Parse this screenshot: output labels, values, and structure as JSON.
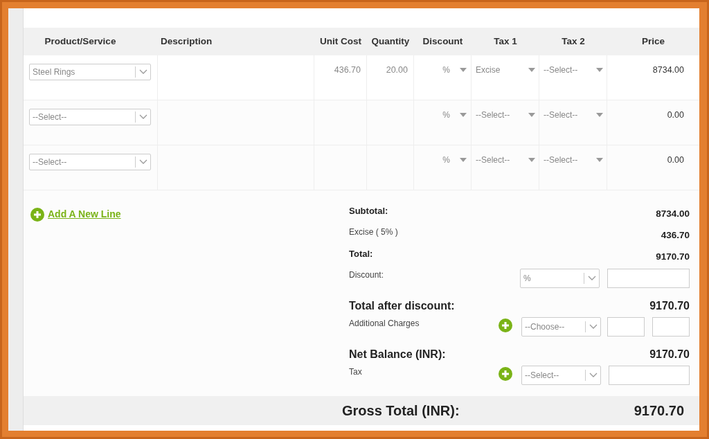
{
  "columns": [
    "Product/Service",
    "Description",
    "Unit Cost",
    "Quantity",
    "Discount",
    "Tax 1",
    "Tax 2",
    "Price"
  ],
  "rows": [
    {
      "product": "Steel Rings",
      "unit_cost": "436.70",
      "quantity": "20.00",
      "discount": "%",
      "tax_1": "Excise",
      "tax_2": "--Select--",
      "price": "8734.00"
    },
    {
      "product": "--Select--",
      "discount": "%",
      "tax_1": "--Select--",
      "tax_2": "--Select--",
      "price": "0.00"
    },
    {
      "product": "--Select--",
      "discount": "%",
      "tax_1": "--Select--",
      "tax_2": "--Select--",
      "price": "0.00"
    }
  ],
  "add_line": "Add A New Line",
  "summary": [
    {
      "kind": "bold",
      "label": "Subtotal:",
      "value": "8734.00"
    },
    {
      "kind": "plain",
      "label": "Excise ( 5% )",
      "value": "436.70"
    },
    {
      "kind": "bold",
      "label": "Total:",
      "value": "9170.70"
    },
    {
      "kind": "discount",
      "label": "Discount:",
      "select": "%"
    },
    {
      "kind": "large",
      "label": "Total after discount:",
      "value": "9170.70"
    },
    {
      "kind": "charges",
      "label": "Additional Charges",
      "select": "--Choose--"
    },
    {
      "kind": "large",
      "label": "Net Balance (INR):",
      "value": "9170.70"
    },
    {
      "kind": "tax",
      "label": "Tax",
      "select": "--Select--"
    }
  ],
  "gross_total": {
    "label": "Gross Total (INR):",
    "value": "9170.70"
  }
}
